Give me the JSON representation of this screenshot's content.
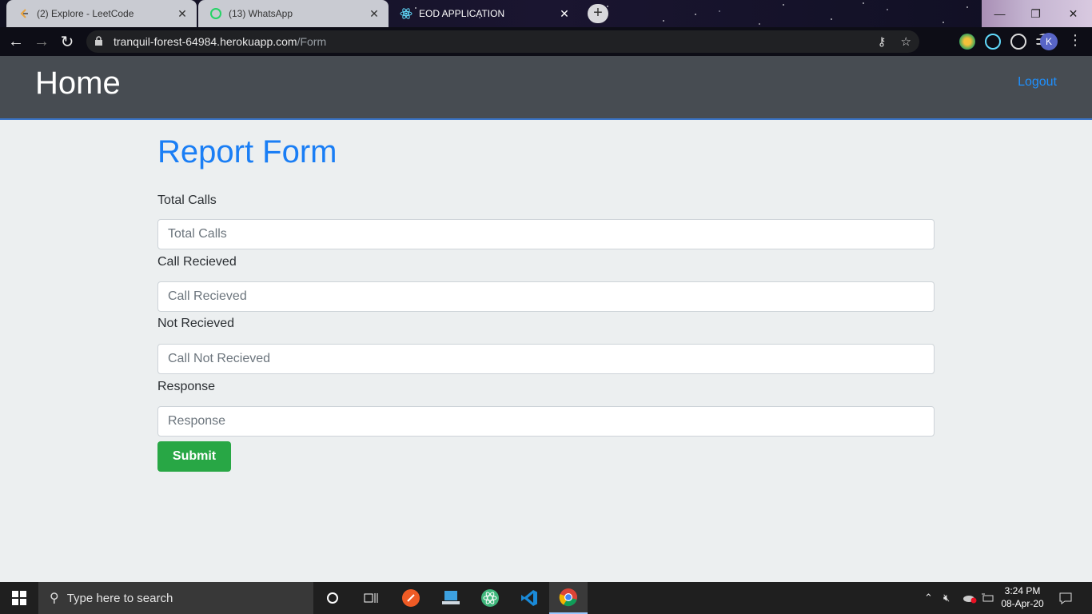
{
  "browser": {
    "tabs": [
      {
        "title": "(2) Explore - LeetCode",
        "icon": "leetcode-icon"
      },
      {
        "title": "(13) WhatsApp",
        "icon": "whatsapp-icon",
        "badge": "13"
      },
      {
        "title": "EOD APPLICATION",
        "icon": "react-icon"
      }
    ],
    "address": {
      "host": "tranquil-forest-64984.herokuapp.com",
      "path": "/Form"
    },
    "profile_initial": "K"
  },
  "navbar": {
    "brand": "Home",
    "logout_label": "Logout"
  },
  "form": {
    "title": "Report Form",
    "fields": [
      {
        "label": "Total Calls",
        "placeholder": "Total Calls"
      },
      {
        "label": "Call Recieved",
        "placeholder": "Call Recieved"
      },
      {
        "label": "Not Recieved",
        "placeholder": "Call Not Recieved"
      },
      {
        "label": "Response",
        "placeholder": "Response"
      }
    ],
    "submit_label": "Submit"
  },
  "taskbar": {
    "search_placeholder": "Type here to search",
    "time": "3:24 PM",
    "date": "08-Apr-20"
  },
  "colors": {
    "brand_blue": "#1a7ef5",
    "submit_green": "#28a745",
    "navbar_bg": "#474c52",
    "page_bg": "#eceff0"
  }
}
